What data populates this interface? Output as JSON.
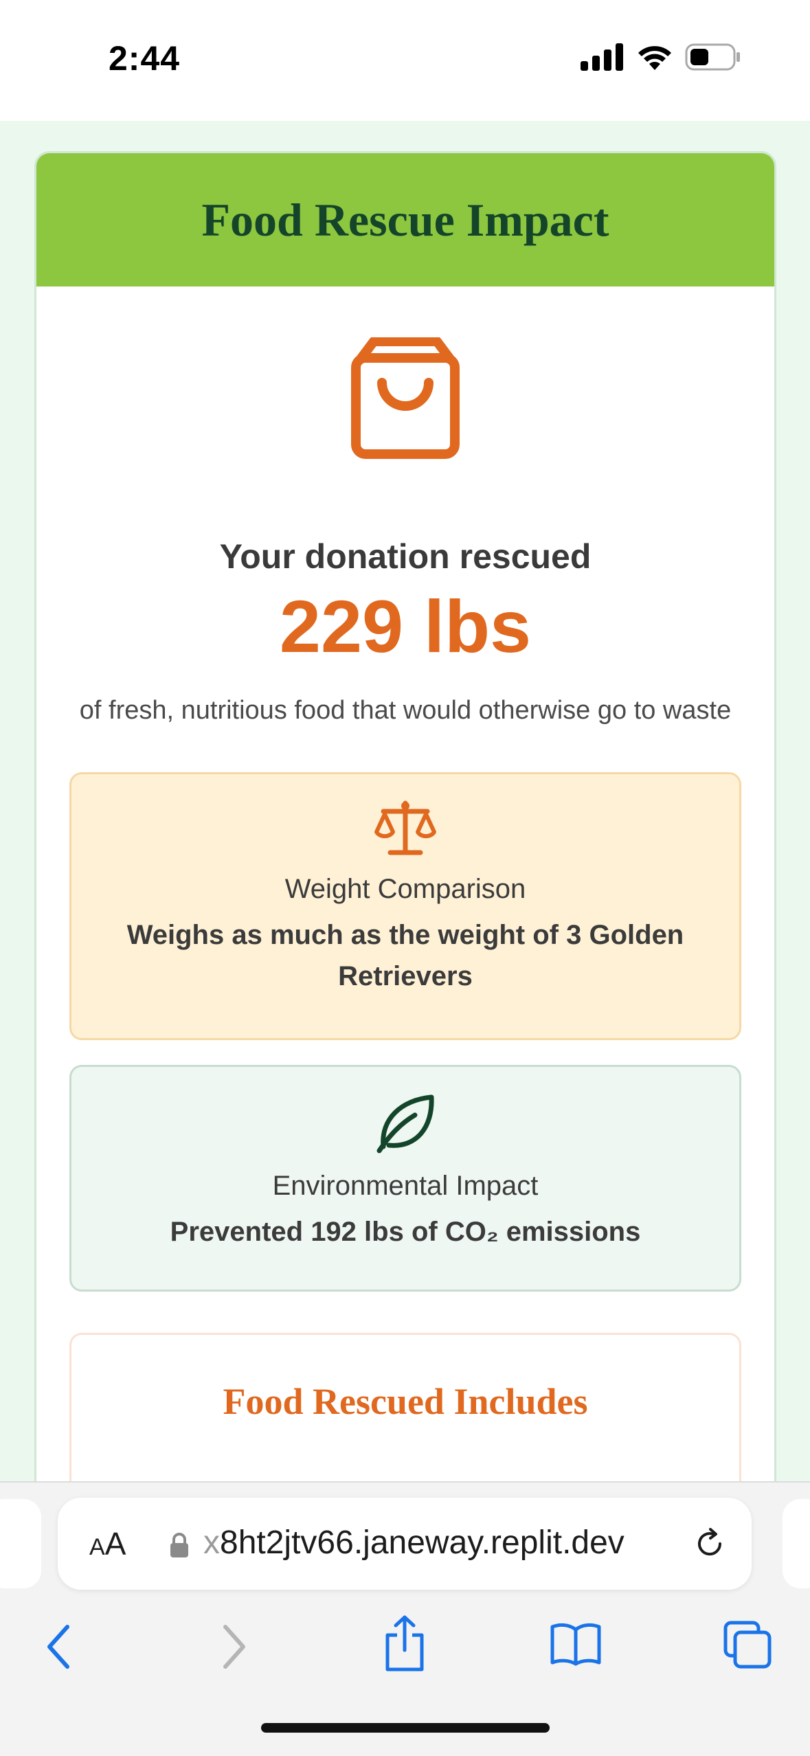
{
  "status_bar": {
    "time": "2:44"
  },
  "card": {
    "title": "Food Rescue Impact",
    "rescued_label": "Your donation rescued",
    "rescued_amount": "229 lbs",
    "rescued_description": "of fresh, nutritious food that would otherwise go to waste",
    "weight_box": {
      "icon": "scale-icon",
      "title": "Weight Comparison",
      "text": "Weighs as much as the weight of 3 Golden Retrievers"
    },
    "env_box": {
      "icon": "leaf-icon",
      "title": "Environmental Impact",
      "text": "Prevented 192 lbs of CO₂ emissions"
    },
    "includes_title": "Food Rescued Includes"
  },
  "browser": {
    "aa_small": "A",
    "aa_large": "A",
    "url_prefix": "x",
    "url_main": "8ht2jtv66.janeway.replit.dev"
  },
  "colors": {
    "header_green": "#8dc63f",
    "title_dark_green": "#14452a",
    "accent_orange": "#e0691f",
    "weight_box_bg": "#fef1d5",
    "env_box_bg": "#eff7f2",
    "ios_blue": "#1a73e8"
  }
}
